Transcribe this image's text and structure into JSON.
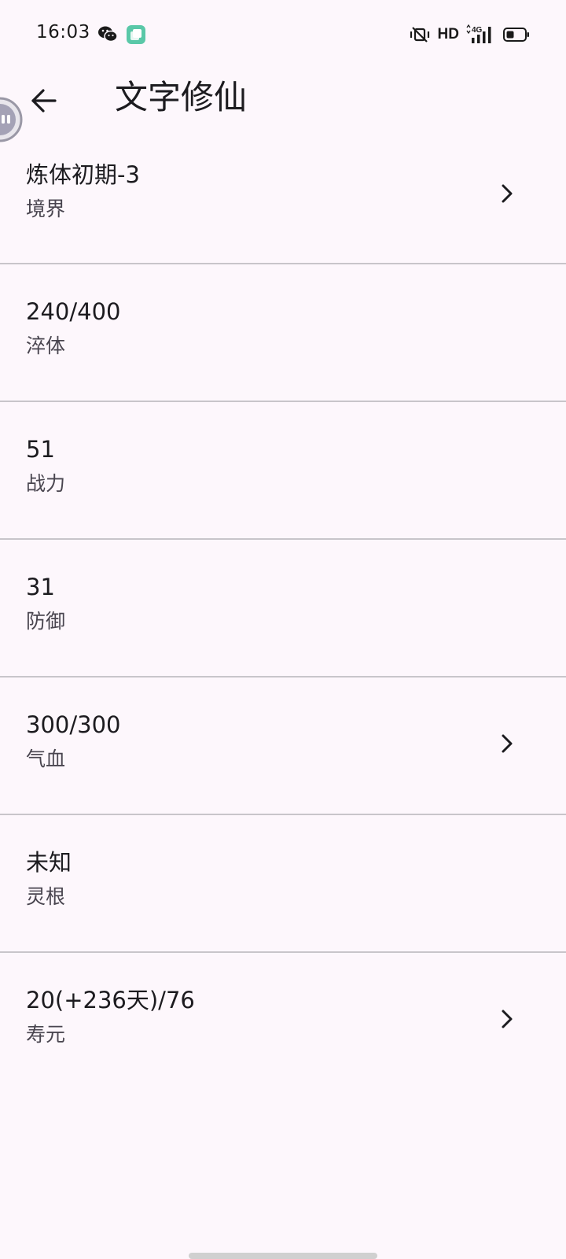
{
  "status_bar": {
    "time": "16:03",
    "network_label": "HD",
    "network_type": "4G"
  },
  "app_bar": {
    "title": "文字修仙"
  },
  "stats": [
    {
      "value": "炼体初期-3",
      "label": "境界",
      "has_chevron": true
    },
    {
      "value": "240/400",
      "label": "淬体",
      "has_chevron": false
    },
    {
      "value": "51",
      "label": "战力",
      "has_chevron": false
    },
    {
      "value": "31",
      "label": "防御",
      "has_chevron": false
    },
    {
      "value": "300/300",
      "label": "气血",
      "has_chevron": true
    },
    {
      "value": "未知",
      "label": "灵根",
      "has_chevron": false
    },
    {
      "value": "20(+236天)/76",
      "label": "寿元",
      "has_chevron": true
    }
  ],
  "colors": {
    "background": "#fdf7fc",
    "divider": "#c8c5ca",
    "primary_text": "#1c1b1f",
    "secondary_text": "#49454f"
  }
}
